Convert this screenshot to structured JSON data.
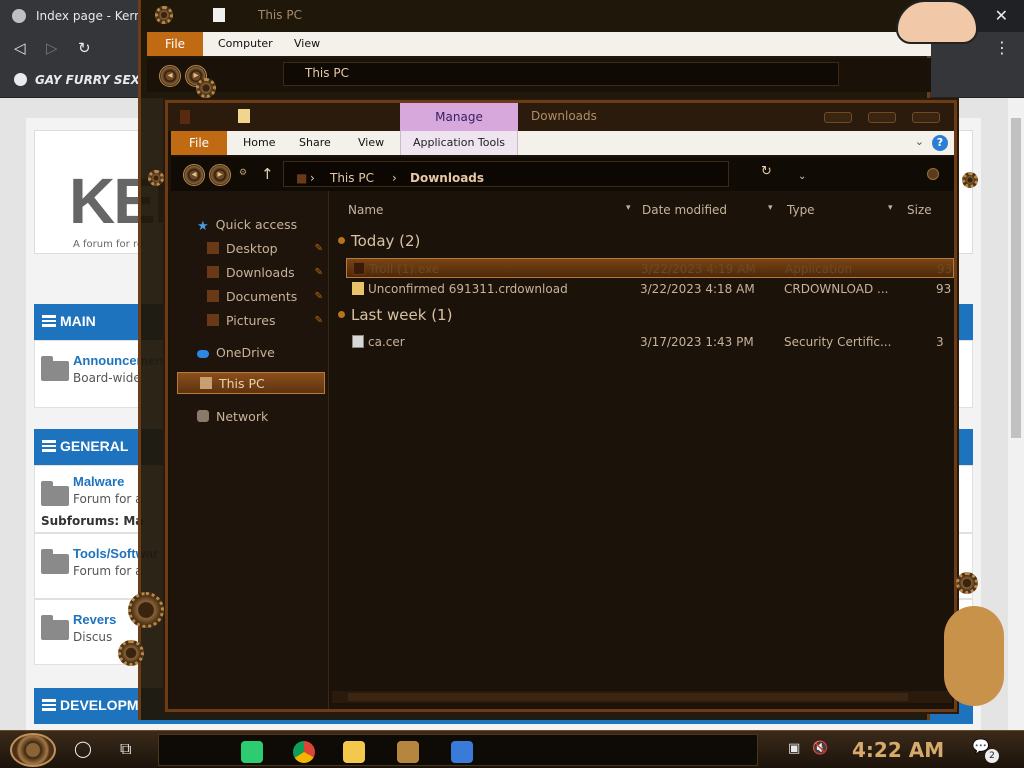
{
  "browser": {
    "tab_title": "Index page - Kern",
    "close_glyph": "✕",
    "back_glyph": "◁",
    "forward_glyph": "▷",
    "reload_glyph": "↻",
    "menu_glyph": "⋮",
    "bookmark_label": "GAY FURRY SEX"
  },
  "forum": {
    "logo_text": "KER",
    "tagline": "A forum for re",
    "categories": [
      {
        "label": "MAIN"
      },
      {
        "label": "GENERAL"
      },
      {
        "label": "DEVELOPM"
      }
    ],
    "rows": [
      {
        "title": "Announcemen",
        "desc": "Board-wide"
      },
      {
        "title": "Malware",
        "desc": "Forum for a",
        "sub": "Subforums: Ma"
      },
      {
        "title": "Tools/Softwar",
        "desc": "Forum for a"
      },
      {
        "title": "Revers",
        "desc": "Discus"
      }
    ]
  },
  "back_window": {
    "title": "This PC",
    "ribbon": {
      "file": "File",
      "tabs": [
        "Computer",
        "View"
      ]
    },
    "address": "This PC"
  },
  "front_window": {
    "manage_tab": "Manage",
    "title": "Downloads",
    "ribbon": {
      "file": "File",
      "tabs": [
        "Home",
        "Share",
        "View"
      ],
      "app_tools": "Application Tools",
      "help": "?",
      "chevron": "⌄"
    },
    "address": {
      "up": "↑",
      "segments": [
        "This PC",
        "Downloads"
      ],
      "separator": "›",
      "dropdown": "⌄",
      "refresh": "↻"
    },
    "nav_pane": {
      "items": [
        {
          "label": "Quick access",
          "icon": "star-icon",
          "color": "#4a9be0"
        },
        {
          "label": "Desktop",
          "icon": "desktop-folder-icon",
          "color": "#6a3a18",
          "pinned": true
        },
        {
          "label": "Downloads",
          "icon": "downloads-folder-icon",
          "color": "#6a3a18",
          "pinned": true
        },
        {
          "label": "Documents",
          "icon": "documents-folder-icon",
          "color": "#6a3a18",
          "pinned": true
        },
        {
          "label": "Pictures",
          "icon": "pictures-folder-icon",
          "color": "#6a3a18",
          "pinned": true
        },
        {
          "label": "OneDrive",
          "icon": "cloud-icon",
          "color": "#2f86e0"
        },
        {
          "label": "This PC",
          "icon": "computer-icon",
          "color": "#c8a070",
          "selected": true
        },
        {
          "label": "Network",
          "icon": "network-icon",
          "color": "#8a7a68"
        }
      ],
      "pin_glyph": "✎"
    },
    "columns": [
      "Name",
      "Date modified",
      "Type",
      "Size"
    ],
    "groups": [
      {
        "label": "Today (2)",
        "files": [
          {
            "name": "Troll (1).exe",
            "date": "3/22/2023 4:19 AM",
            "type": "Application",
            "size": "93",
            "selected": true
          },
          {
            "name": "Unconfirmed 691311.crdownload",
            "date": "3/22/2023 4:18 AM",
            "type": "CRDOWNLOAD ...",
            "size": "93"
          }
        ]
      },
      {
        "label": "Last week (1)",
        "files": [
          {
            "name": "ca.cer",
            "date": "3/17/2023 1:43 PM",
            "type": "Security Certific...",
            "size": "3"
          }
        ]
      }
    ]
  },
  "taskbar": {
    "clock": "4:22 AM",
    "notification_count": "2",
    "search_glyph": "◯",
    "taskview_glyph": "⧉",
    "notif_glyph": "💬"
  },
  "colors": {
    "accent": "#c06a14",
    "forum_blue": "#1e73be",
    "manage_purple": "#d6a8dc",
    "clock": "#d6aa6a"
  }
}
